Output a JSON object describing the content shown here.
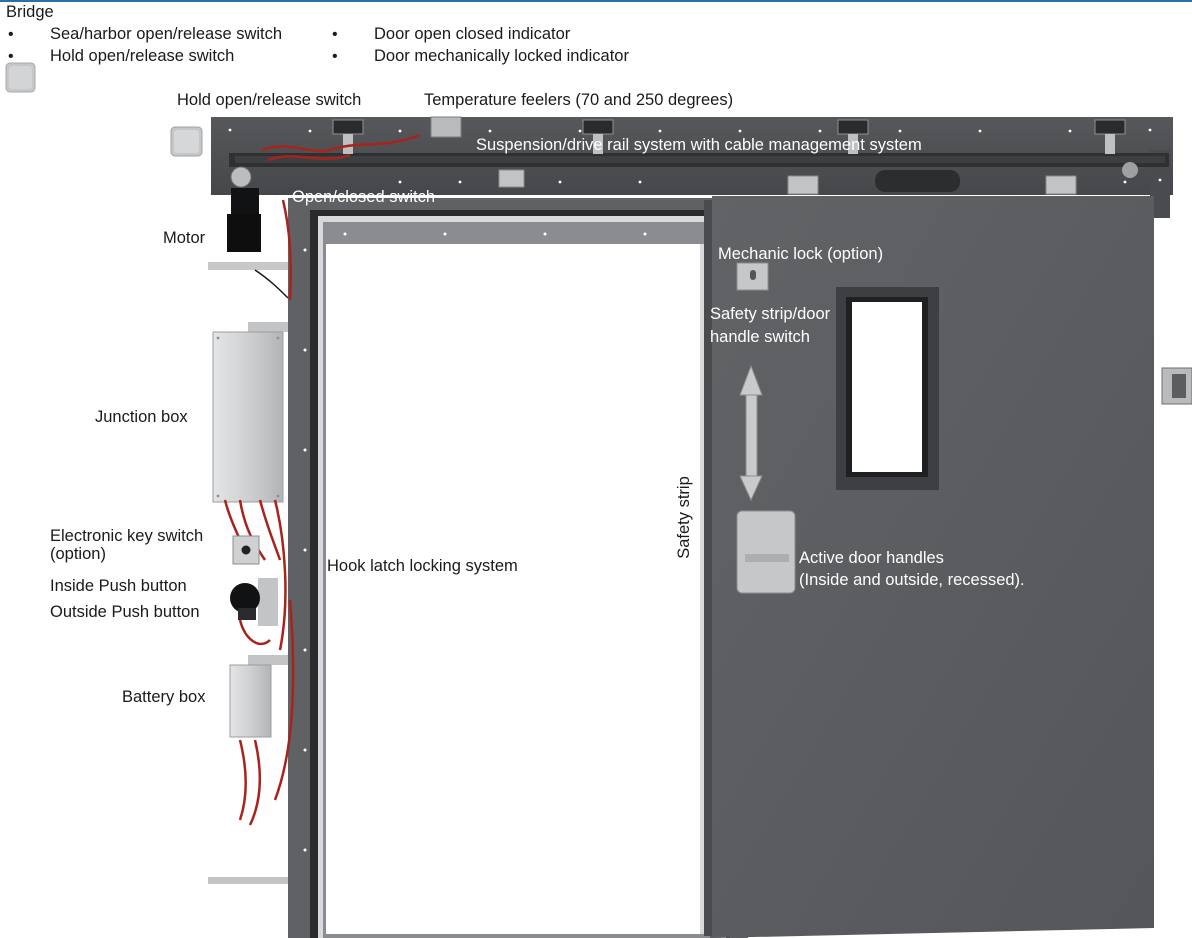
{
  "header": {
    "title": "Bridge",
    "bullets_left": [
      "Sea/harbor open/release switch",
      "Hold open/release switch"
    ],
    "bullets_right": [
      "Door open closed indicator",
      "Door mechanically locked indicator"
    ]
  },
  "labels": {
    "hold_open_switch": "Hold open/release switch",
    "temperature_feelers": "Temperature feelers (70 and 250 degrees)",
    "suspension_rail": "Suspension/drive rail system with cable management system",
    "open_closed_switch": "Open/closed switch",
    "motor": "Motor",
    "mechanic_lock": "Mechanic lock (option)",
    "safety_strip_handle_switch": [
      "Safety strip/door",
      "handle switch"
    ],
    "junction_box": "Junction box",
    "electronic_key_switch": [
      "Electronic key switch",
      "(option)"
    ],
    "inside_push_button": "Inside Push button",
    "outside_push_button": "Outside Push button",
    "hook_latch": "Hook latch locking system",
    "safety_strip": "Safety strip",
    "active_door_handles": [
      "Active door handles",
      "(Inside and outside, recessed)."
    ],
    "battery_box": "Battery box"
  },
  "colors": {
    "accent_line": "#2b6fa3",
    "door_panel": "#5a5c5f",
    "rail_housing": "#4c4d50",
    "cable": "#a8231c",
    "box_grey": "#c9cacc"
  }
}
